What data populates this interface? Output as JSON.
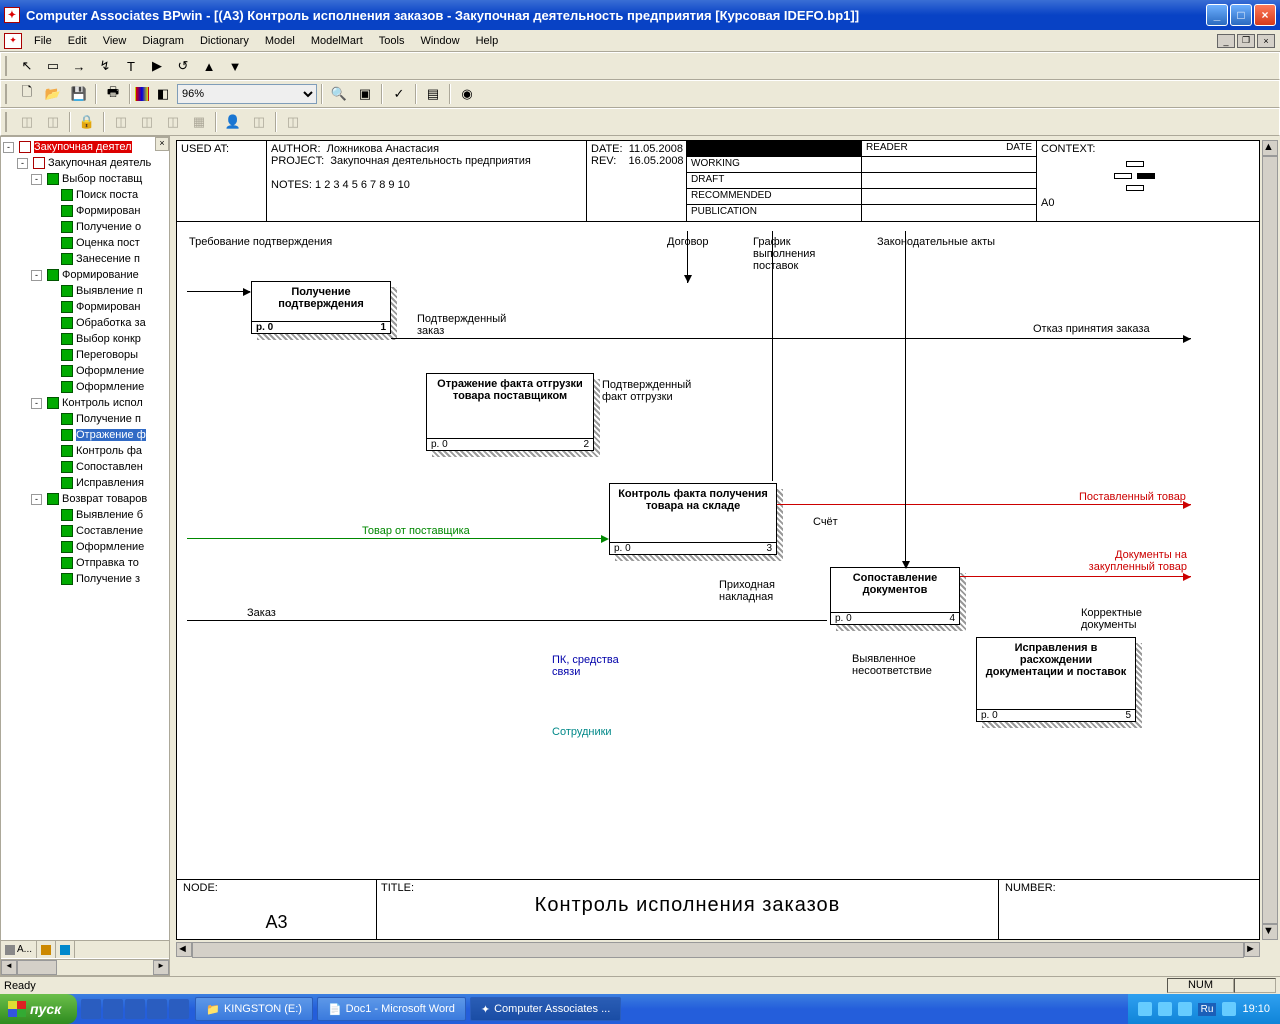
{
  "window": {
    "title": "Computer Associates BPwin - [(A3) Контроль  исполнения  заказов - Закупочная деятельность предприятия  [Курсовая IDEFO.bp1]]"
  },
  "menu": {
    "items": [
      "File",
      "Edit",
      "View",
      "Diagram",
      "Dictionary",
      "Model",
      "ModelMart",
      "Tools",
      "Window",
      "Help"
    ]
  },
  "zoom": "96%",
  "tree": {
    "root": "Закупочная деятел",
    "items": [
      {
        "lvl": 1,
        "exp": "-",
        "label": "Закупочная деятель",
        "ic": "top"
      },
      {
        "lvl": 2,
        "exp": "-",
        "label": "Выбор поставщ"
      },
      {
        "lvl": 3,
        "label": "Поиск поста"
      },
      {
        "lvl": 3,
        "label": "Формирован"
      },
      {
        "lvl": 3,
        "label": "Получение о"
      },
      {
        "lvl": 3,
        "label": "Оценка пост"
      },
      {
        "lvl": 3,
        "label": "Занесение п"
      },
      {
        "lvl": 2,
        "exp": "-",
        "label": "Формирование"
      },
      {
        "lvl": 3,
        "label": "Выявление п"
      },
      {
        "lvl": 3,
        "label": "Формирован"
      },
      {
        "lvl": 3,
        "label": "Обработка за"
      },
      {
        "lvl": 3,
        "label": "Выбор конкр"
      },
      {
        "lvl": 3,
        "label": "Переговоры"
      },
      {
        "lvl": 3,
        "label": "Оформление"
      },
      {
        "lvl": 3,
        "label": "Оформление"
      },
      {
        "lvl": 2,
        "exp": "-",
        "label": "Контроль испол"
      },
      {
        "lvl": 3,
        "label": "Получение п"
      },
      {
        "lvl": 3,
        "label": "Отражение ф",
        "sel": true
      },
      {
        "lvl": 3,
        "label": "Контроль фа"
      },
      {
        "lvl": 3,
        "label": "Сопоставлен"
      },
      {
        "lvl": 3,
        "label": "Исправления"
      },
      {
        "lvl": 2,
        "exp": "-",
        "label": "Возврат товаров"
      },
      {
        "lvl": 3,
        "label": "Выявление б"
      },
      {
        "lvl": 3,
        "label": "Составление"
      },
      {
        "lvl": 3,
        "label": "Оформление"
      },
      {
        "lvl": 3,
        "label": "Отправка то"
      },
      {
        "lvl": 3,
        "label": "Получение з"
      }
    ],
    "tabs": [
      "A...",
      "",
      ""
    ]
  },
  "idef": {
    "used_at_label": "USED AT:",
    "author_label": "AUTHOR:",
    "author": "Ложникова Анастасия",
    "project_label": "PROJECT:",
    "project": "Закупочная деятельность предприятия",
    "notes_label": "NOTES:",
    "notes": "1  2  3  4  5  6  7  8  9  10",
    "date_label": "DATE:",
    "date": "11.05.2008",
    "rev_label": "REV:",
    "rev": "16.05.2008",
    "status": [
      "WORKING",
      "DRAFT",
      "RECOMMENDED",
      "PUBLICATION"
    ],
    "reader_label": "READER",
    "reader_date_label": "DATE",
    "context_label": "CONTEXT:",
    "context_val": "A0",
    "node_label": "NODE:",
    "node": "A3",
    "title_label": "TITLE:",
    "title": "Контроль  исполнения  заказов",
    "number_label": "NUMBER:"
  },
  "boxes": {
    "b1": {
      "title": "Получение подтверждения",
      "p": "p. 0",
      "n": "1"
    },
    "b2": {
      "title": "Отражение факта отгрузки товара поставщиком",
      "p": "p. 0",
      "n": "2"
    },
    "b3": {
      "title": "Контроль факта получения товара на складе",
      "p": "p. 0",
      "n": "3"
    },
    "b4": {
      "title": "Сопоставление документов",
      "p": "p. 0",
      "n": "4"
    },
    "b5": {
      "title": "Исправления в расхождении документации и поставок",
      "p": "p. 0",
      "n": "5"
    }
  },
  "labels": {
    "l_req": "Требование подтверждения",
    "l_dog": "Договор",
    "l_graf": "График выполнения поставок",
    "l_zak": "Законодательные акты",
    "l_podz": "Подтвержденный заказ",
    "l_otkaz": "Отказ принятия заказа",
    "l_podfakt": "Подтвержденный факт отгрузки",
    "l_tovpost": "Товар от поставщика",
    "l_postav": "Поставленный товар",
    "l_schet": "Счёт",
    "l_prih": "Приходная накладная",
    "l_dokzak": "Документы на закупленный товар",
    "l_korr": "Корректные документы",
    "l_nesoot": "Выявленное несоответствие",
    "l_zakaz": "Заказ",
    "l_pk": "ПК, средства связи",
    "l_sotr": "Сотрудники"
  },
  "statusbar": {
    "ready": "Ready",
    "num": "NUM"
  },
  "taskbar": {
    "start": "пуск",
    "tasks": [
      {
        "label": "KINGSTON (E:)"
      },
      {
        "label": "Doc1 - Microsoft Word"
      },
      {
        "label": "Computer Associates ...",
        "active": true
      }
    ],
    "lang": "Ru",
    "time": "19:10"
  }
}
